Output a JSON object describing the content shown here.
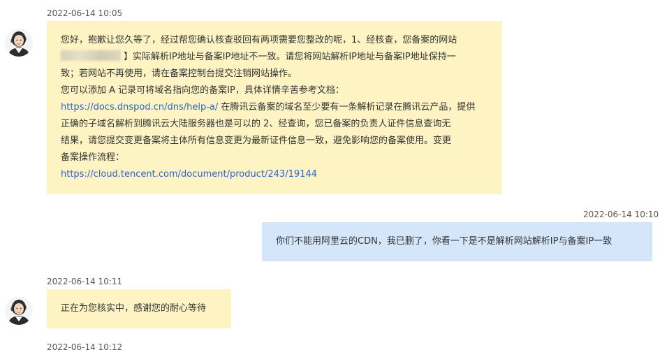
{
  "messages": [
    {
      "role": "agent",
      "timestamp": "2022-06-14 10:05",
      "lines": [
        "您好，抱歉让您久等了，经过帮您确认核查驳回有两项需要您整改的呢，1、经核查，您备案的网站",
        "】实际解析IP地址与备案IP地址不一致。请您将网站解析IP地址与备案IP地址保持一",
        "致；若网站不再使用，请在备案控制台提交注销网站操作。",
        "您可以添加 A 记录可将域名指向您的备案IP，具体详情辛苦参考文档：",
        "在腾讯云备案的域名至少要有一条解析记录在腾讯云产品，提供",
        "正确的子域名解析到腾讯云大陆服务器也是可以的 2、经查询，您已备案的负责人证件信息查询无",
        "结果，请您提交变更备案将主体所有信息变更为最新证件信息一致，避免影响您的备案使用。变更",
        "备案操作流程："
      ],
      "links": [
        "https://docs.dnspod.cn/dns/help-a/",
        "https://cloud.tencent.com/document/product/243/19144"
      ]
    },
    {
      "role": "user",
      "timestamp": "2022-06-14 10:10",
      "text": "你们不能用阿里云的CDN，我已删了，你看一下是不是解析网站解析IP与备案IP一致"
    },
    {
      "role": "agent",
      "timestamp": "2022-06-14 10:11",
      "text": "正在为您核实中，感谢您的耐心等待"
    },
    {
      "role": "agent",
      "timestamp": "2022-06-14 10:12"
    }
  ],
  "colors": {
    "agent_bubble": "#fdf3c3",
    "user_bubble": "#d5e6fb",
    "link": "#2d63c8"
  },
  "icons": {
    "agent_avatar": "agent-avatar-icon"
  }
}
